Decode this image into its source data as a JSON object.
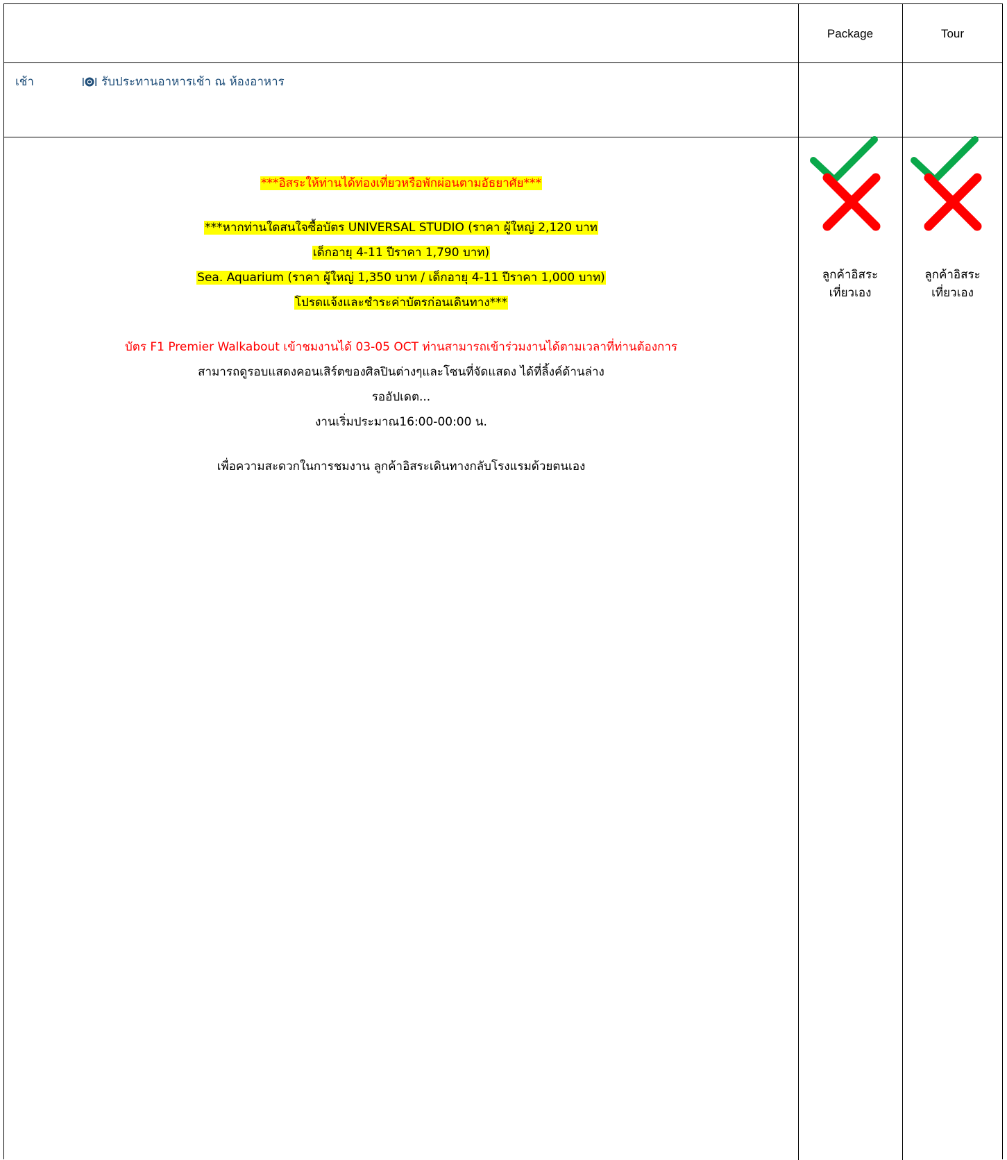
{
  "columns": {
    "package": "Package",
    "tour": "Tour"
  },
  "breakfast": {
    "time": "เช้า",
    "icon": "plate-cutlery-icon",
    "description": "รับประทานอาหารเช้า ณ ห้องอาหาร",
    "package_included": true,
    "tour_included": true
  },
  "free_day": {
    "headline": "***อิสระให้ท่านได้ท่องเที่ยวหรือพักผ่อนตามอัธยาศัย***",
    "ticket_lines": [
      "***หากท่านใดสนใจซื้อบัตร UNIVERSAL STUDIO (ราคา ผู้ใหญ่ 2,120 บาท",
      "เด็กอายุ 4-11 ปีราคา 1,790 บาท)",
      "Sea. Aquarium (ราคา ผู้ใหญ่ 1,350 บาท / เด็กอายุ 4-11 ปีราคา 1,000 บาท)",
      "โปรดแจ้งและชำระค่าบัตรก่อนเดินทาง***"
    ],
    "f1_notice": "บัตร F1 Premier Walkabout เข้าชมงานได้ 03-05 OCT ท่านสามารถเข้าร่วมงานได้ตามเวลาที่ท่านต้องการ",
    "concert_info": "สามารถดูรอบแสดงคอนเสิร์ตของศิลปินต่างๆและโซนที่จัดแสดง ได้ที่ลิ้งค์ด้านล่าง",
    "update_note": "รออัปเดต...",
    "start_time": "งานเริ่มประมาณ16:00-00:00 น.",
    "return_note": "เพื่อความสะดวกในการชมงาน ลูกค้าอิสระเดินทางกลับโรงแรมด้วยตนเอง",
    "package_included": false,
    "tour_included": false,
    "package_note_1": "ลูกค้าอิสระ",
    "package_note_2": "เที่ยวเอง",
    "tour_note_1": "ลูกค้าอิสระ",
    "tour_note_2": "เที่ยวเอง"
  },
  "colors": {
    "text_blue": "#1f4e79",
    "check_green": "#0aa84a",
    "cross_red": "#ff0000",
    "highlight": "#ffff00"
  }
}
